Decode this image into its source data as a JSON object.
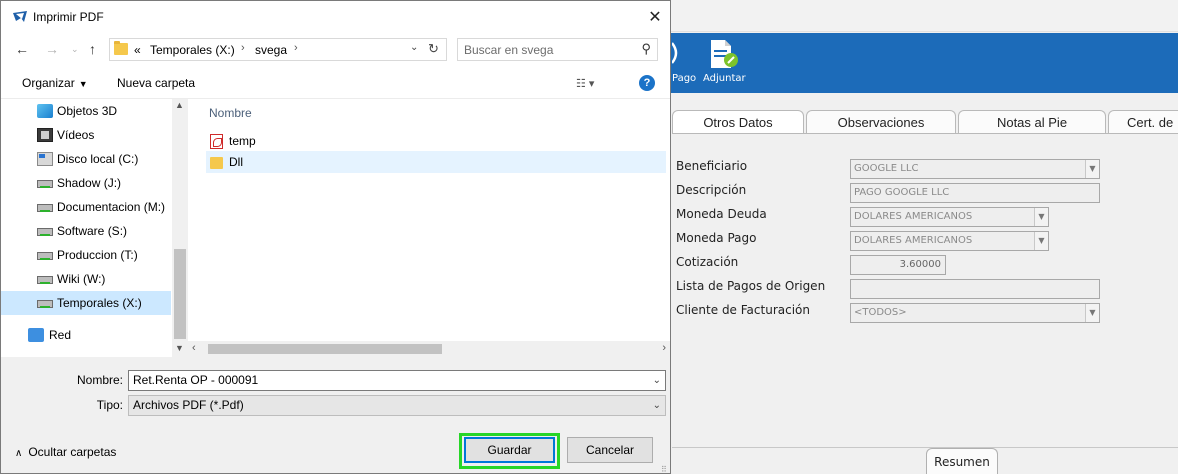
{
  "background_app": {
    "toolbar": {
      "pago_label": "Pago",
      "adjuntar_label": "Adjuntar"
    },
    "tabs": [
      "Otros Datos",
      "Observaciones",
      "Notas al Pie",
      "Cert. de"
    ],
    "fields": {
      "beneficiario": {
        "label": "Beneficiario",
        "value": "GOOGLE LLC"
      },
      "descripcion": {
        "label": "Descripción",
        "value": "PAGO GOOGLE LLC"
      },
      "moneda_deuda": {
        "label": "Moneda Deuda",
        "value": "DOLARES AMERICANOS"
      },
      "moneda_pago": {
        "label": "Moneda Pago",
        "value": "DOLARES AMERICANOS"
      },
      "cotizacion": {
        "label": "Cotización",
        "value": "3.60000"
      },
      "lista_pagos": {
        "label": "Lista de Pagos de Origen",
        "value": ""
      },
      "cliente_facturacion": {
        "label": "Cliente de Facturación",
        "value": "<TODOS>"
      }
    },
    "bottom_tab": "Resumen",
    "accent_color": "#1c6bb9"
  },
  "dialog": {
    "title": "Imprimir PDF",
    "address": {
      "overflow": "«",
      "crumbs": [
        "Temporales (X:)",
        "svega"
      ]
    },
    "search_placeholder": "Buscar en svega",
    "commands": {
      "organize": "Organizar",
      "new_folder": "Nueva carpeta"
    },
    "nav_items": [
      {
        "label": "Objetos 3D",
        "icon": "3d-objects-icon"
      },
      {
        "label": "Vídeos",
        "icon": "videos-icon"
      },
      {
        "label": "Disco local (C:)",
        "icon": "local-disk-icon"
      },
      {
        "label": "Shadow (J:)",
        "icon": "network-drive-icon"
      },
      {
        "label": "Documentacion (M:)",
        "icon": "network-drive-icon"
      },
      {
        "label": "Software (S:)",
        "icon": "network-drive-icon"
      },
      {
        "label": "Produccion (T:)",
        "icon": "network-drive-icon"
      },
      {
        "label": "Wiki (W:)",
        "icon": "network-drive-icon"
      },
      {
        "label": "Temporales (X:)",
        "icon": "network-drive-icon",
        "selected": true
      },
      {
        "label": "Red",
        "icon": "network-icon"
      }
    ],
    "file_list": {
      "column_header": "Nombre",
      "items": [
        {
          "name": "temp",
          "icon": "pdf-file-icon"
        },
        {
          "name": "Dll",
          "icon": "folder-icon"
        }
      ]
    },
    "form": {
      "name_label": "Nombre:",
      "name_value": "Ret.Renta OP - 000091",
      "type_label": "Tipo:",
      "type_value": "Archivos PDF (*.Pdf)"
    },
    "hide_folders": "Ocultar carpetas",
    "save_label": "Guardar",
    "cancel_label": "Cancelar",
    "highlight_color": "#27d627"
  }
}
